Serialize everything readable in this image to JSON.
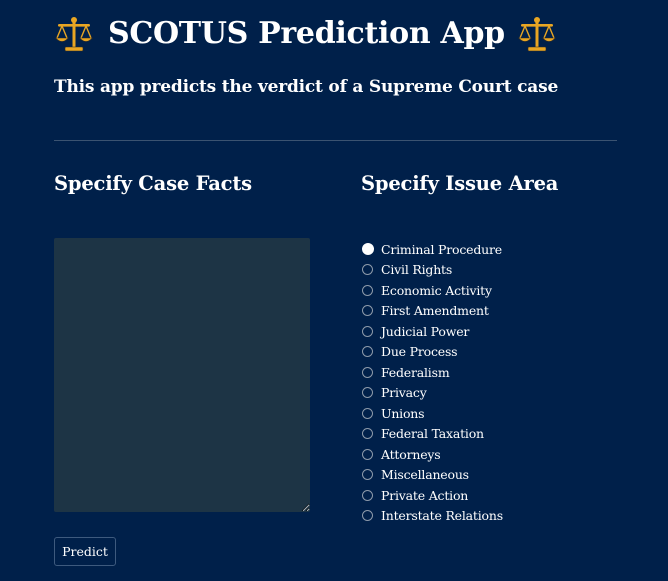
{
  "header": {
    "title": "SCOTUS Prediction App",
    "left_icon": "balance-scale-icon",
    "right_icon": "balance-scale-icon",
    "subtitle": "This app predicts the verdict of a Supreme Court case"
  },
  "case_facts": {
    "heading": "Specify Case Facts",
    "value": ""
  },
  "issue_area": {
    "heading": "Specify Issue Area",
    "selected": "Criminal Procedure",
    "options": [
      "Criminal Procedure",
      "Civil Rights",
      "Economic Activity",
      "First Amendment",
      "Judicial Power",
      "Due Process",
      "Federalism",
      "Privacy",
      "Unions",
      "Federal Taxation",
      "Attorneys",
      "Miscellaneous",
      "Private Action",
      "Interstate Relations"
    ]
  },
  "actions": {
    "predict_label": "Predict"
  },
  "colors": {
    "background": "#00204a",
    "text": "#ffffff",
    "textarea_bg": "#1d3445",
    "icon_gold": "#e9a623"
  }
}
